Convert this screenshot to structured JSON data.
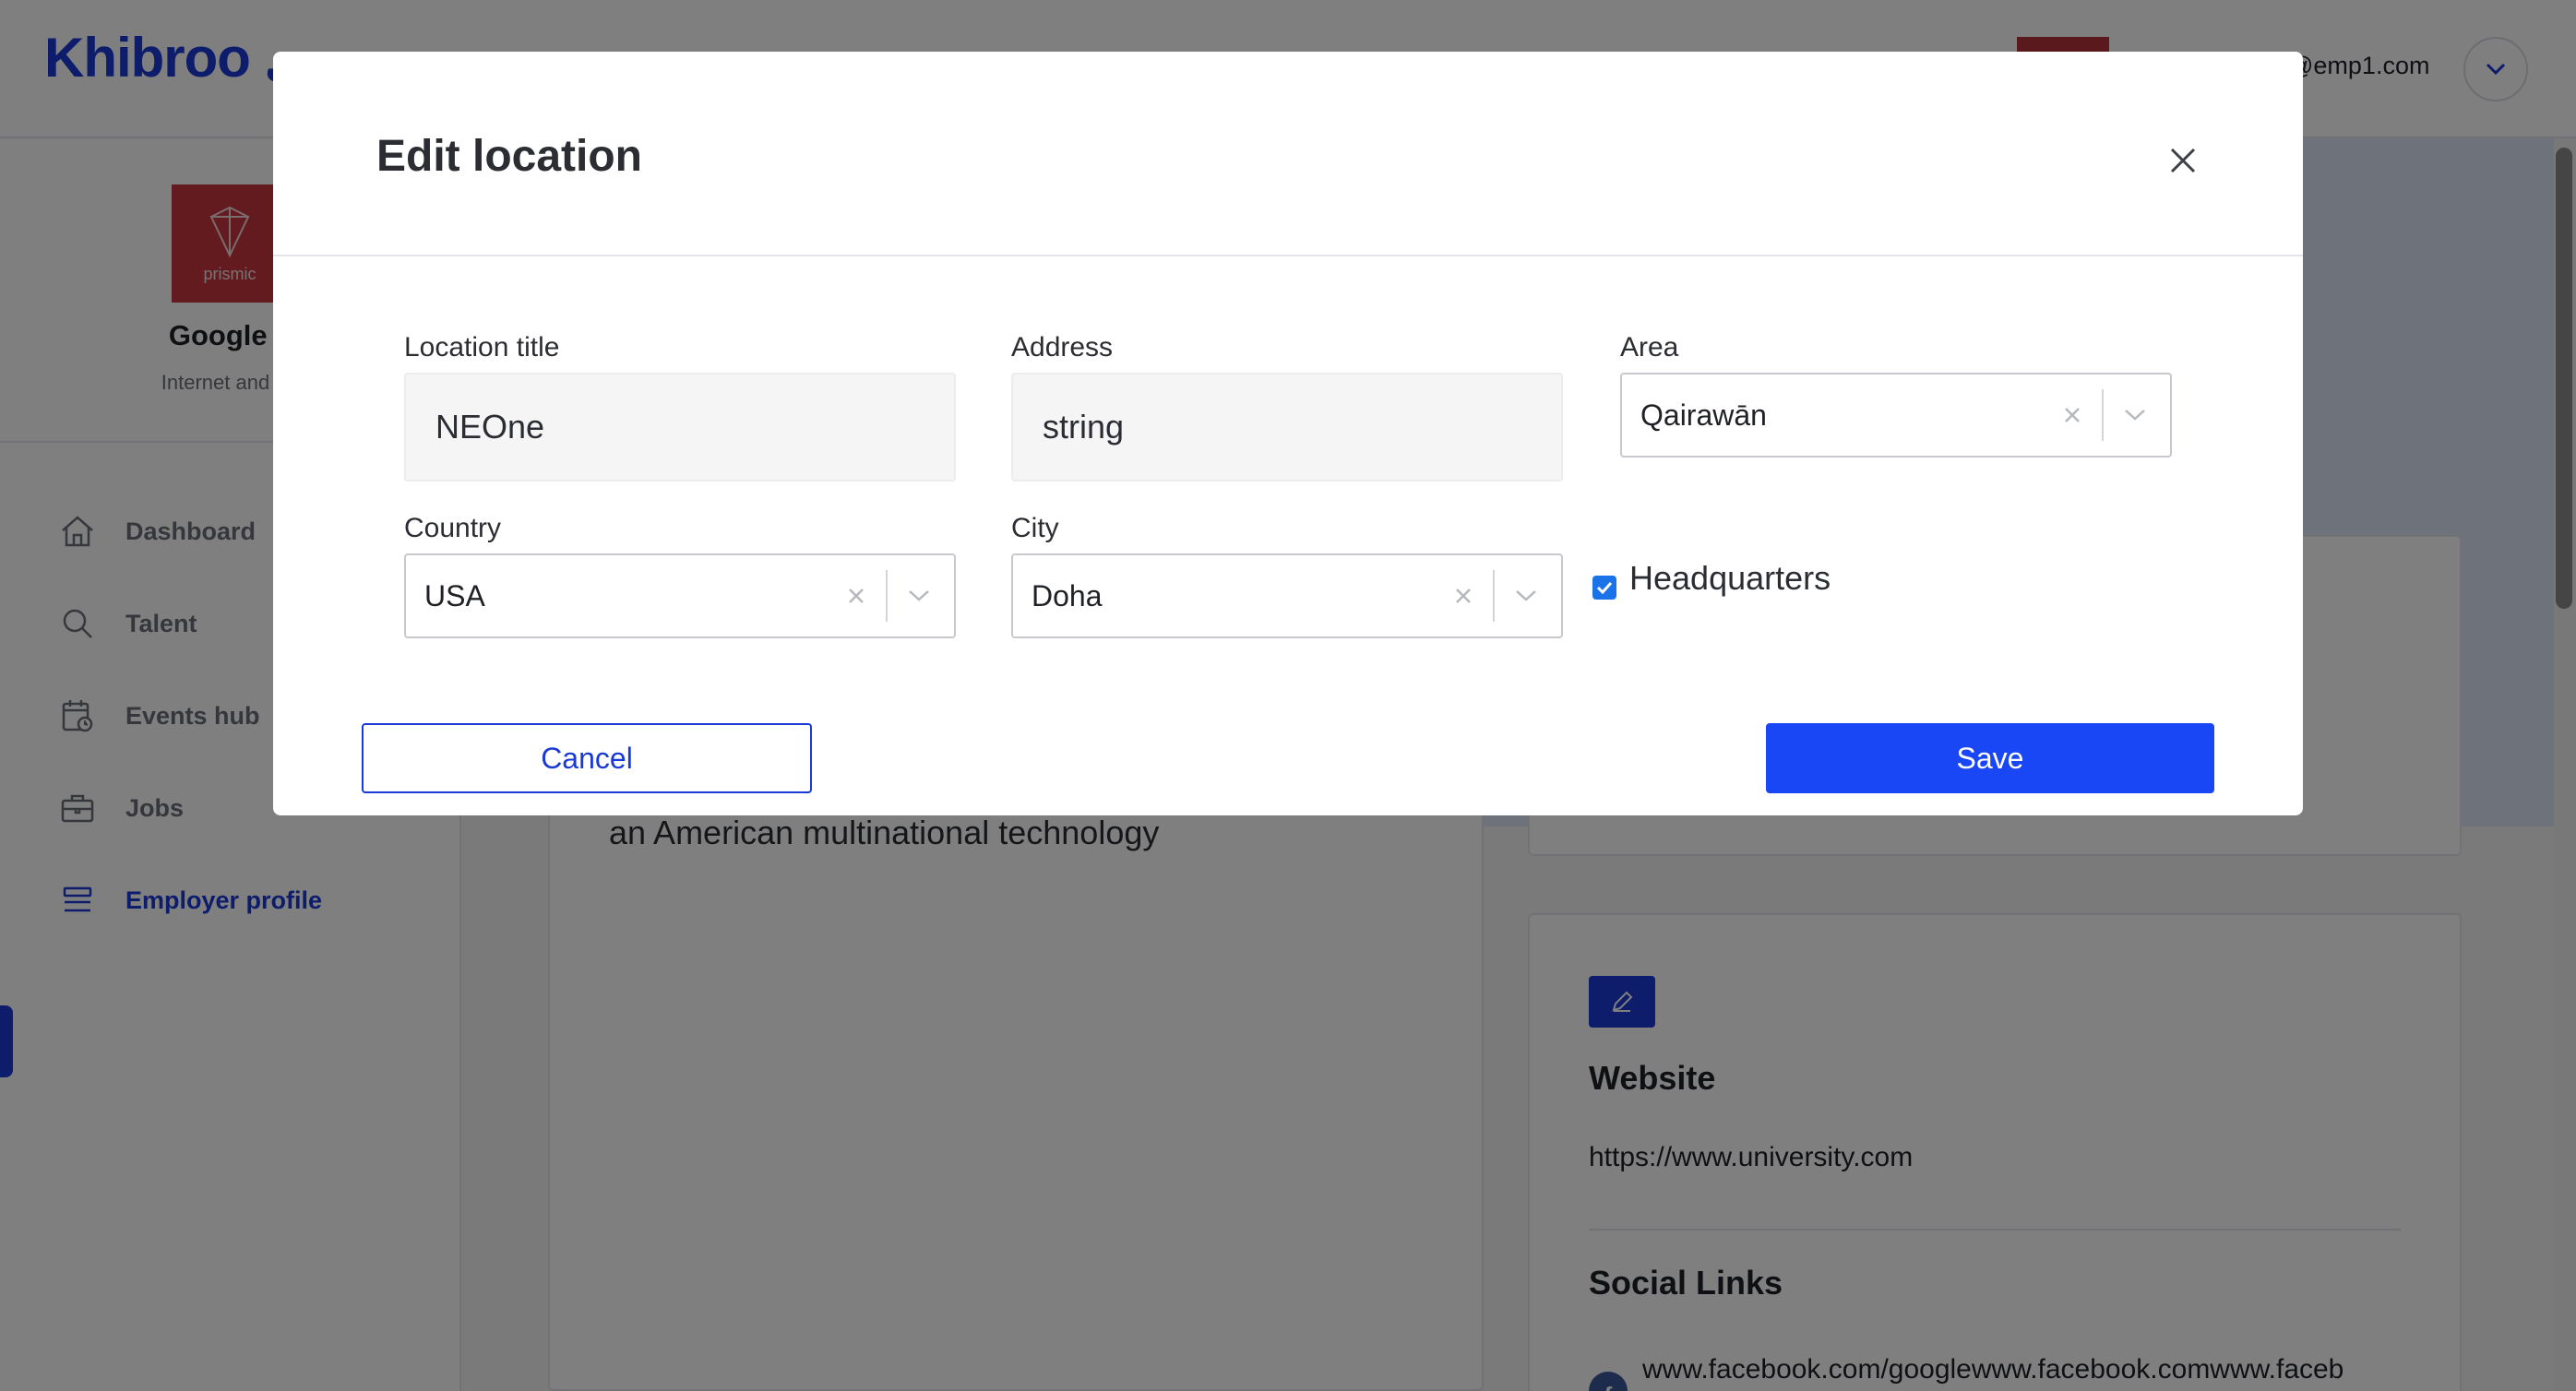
{
  "header": {
    "logo": "Khibroo",
    "logo_arabic": "خبيرتي",
    "user_email": "@emp1.com"
  },
  "sidebar": {
    "company_name": "Google L",
    "company_industry": "Internet and So",
    "company_logo_text": "prismic",
    "items": [
      {
        "label": "Dashboard",
        "icon": "home-icon"
      },
      {
        "label": "Talent",
        "icon": "search-icon"
      },
      {
        "label": "Events hub",
        "icon": "calendar-icon"
      },
      {
        "label": "Jobs",
        "icon": "briefcase-icon"
      },
      {
        "label": "Employer profile",
        "icon": "profile-list-icon",
        "active": true
      }
    ]
  },
  "main": {
    "about_text": "an American multinational technology",
    "website_heading": "Website",
    "website_url": "https://www.university.com",
    "social_heading": "Social Links",
    "facebook_link": "www.facebook.com/googlewww.facebook.comwww.faceb"
  },
  "modal": {
    "title": "Edit location",
    "fields": {
      "location_title": {
        "label": "Location title",
        "value": "NEOne"
      },
      "address": {
        "label": "Address",
        "value": "string"
      },
      "area": {
        "label": "Area",
        "value": "Qairawān"
      },
      "country": {
        "label": "Country",
        "value": "USA"
      },
      "city": {
        "label": "City",
        "value": "Doha"
      }
    },
    "headquarters": {
      "label": "Headquarters",
      "checked": true
    },
    "cancel_label": "Cancel",
    "save_label": "Save"
  },
  "colors": {
    "brand_blue": "#1a3ad6",
    "save_button": "#1a47f5",
    "checkbox": "#1a73e8",
    "logo_red": "#c9373f"
  }
}
